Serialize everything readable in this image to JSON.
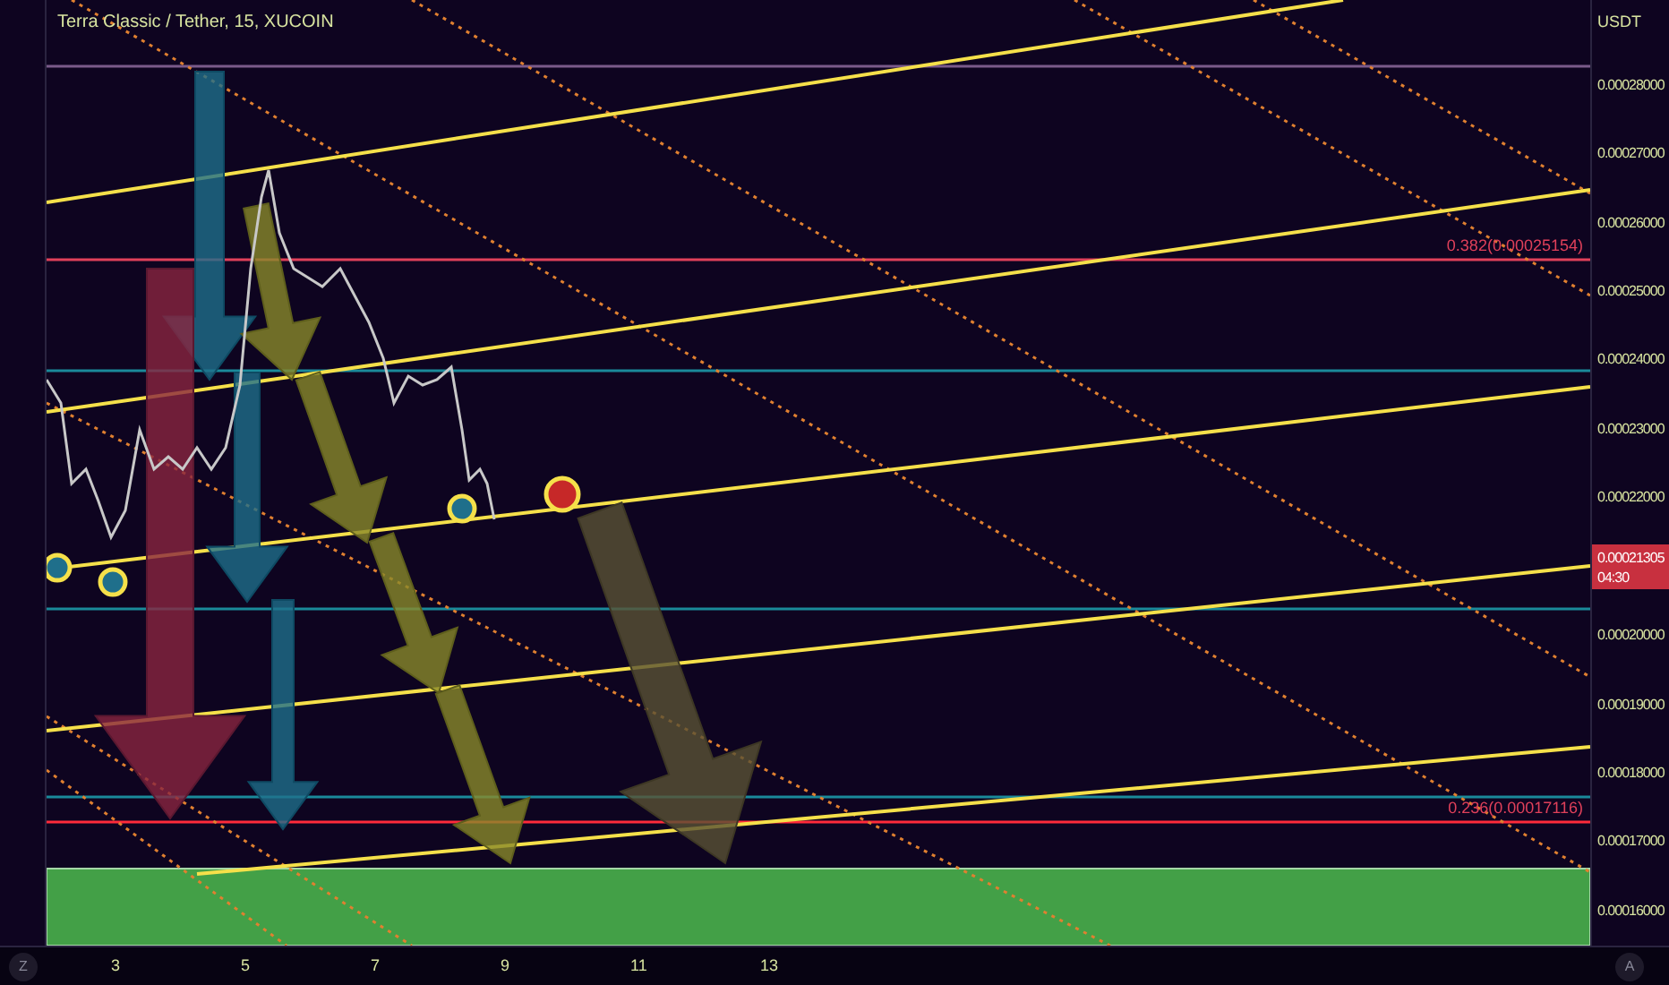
{
  "title": "Terra Classic / Tether, 15, XUCOIN",
  "fib_labels": [
    {
      "text": "0.382(0.00025154)",
      "kind": "upper"
    },
    {
      "text": "0.236(0.00017116)",
      "kind": "lower"
    }
  ],
  "price_axis": {
    "unit": "USDT",
    "items": [
      {
        "kind": "price",
        "text": "0.00028000"
      },
      {
        "kind": "price",
        "text": "0.00027000"
      },
      {
        "kind": "price",
        "text": "0.00026000"
      },
      {
        "kind": "price",
        "text": "0.00025000"
      },
      {
        "kind": "price",
        "text": "0.00024000"
      },
      {
        "kind": "price",
        "text": "0.00023000"
      },
      {
        "kind": "price",
        "text": "0.00022000"
      },
      {
        "kind": "badge",
        "text": "0.00021305",
        "countdown": "04:30"
      },
      {
        "kind": "price",
        "text": "0.00020000"
      },
      {
        "kind": "price",
        "text": "0.00019000"
      },
      {
        "kind": "price",
        "text": "0.00018000"
      },
      {
        "kind": "price",
        "text": "0.00017000"
      },
      {
        "kind": "price",
        "text": "0.00016000"
      }
    ]
  },
  "time_axis": [
    "3",
    "5",
    "7",
    "9",
    "11",
    "13"
  ],
  "left_button": "Z",
  "right_button": "A"
}
